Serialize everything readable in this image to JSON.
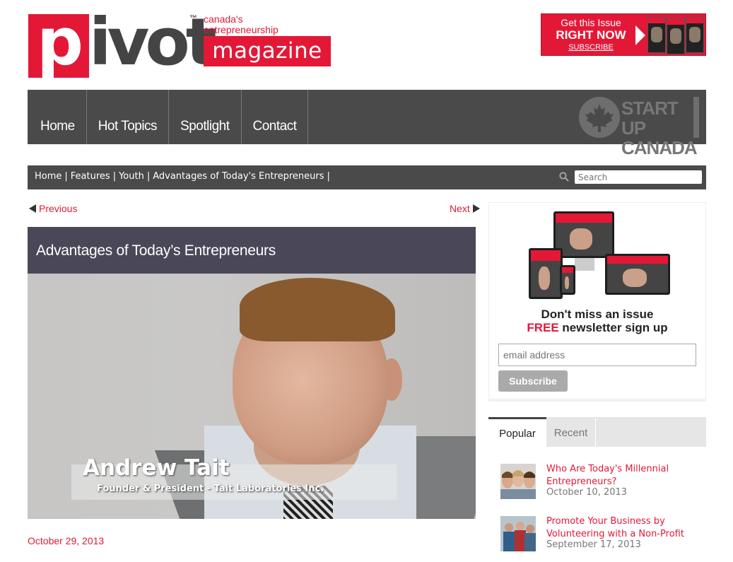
{
  "header": {
    "logo_p": "p",
    "logo_rest": "ivot",
    "logo_tm": "™",
    "tagline_1": "canada's",
    "tagline_2": "entrepreneurship",
    "logo_magazine": "magazine",
    "promo_line1": "Get this Issue",
    "promo_line2": "RIGHT NOW",
    "promo_line3": "SUBSCRIBE"
  },
  "nav": {
    "items": [
      "Home",
      "Hot Topics",
      "Spotlight",
      "Contact"
    ],
    "startup_1": "START UP",
    "startup_2": "CANADA"
  },
  "breadcrumb": {
    "items": [
      "Home",
      "Features",
      "Youth",
      "Advantages of Today's Entrepreneurs"
    ],
    "separator": "|",
    "search_placeholder": "Search"
  },
  "pager": {
    "previous": "Previous",
    "next": "Next"
  },
  "article": {
    "title": "Advantages of Today’s Entrepreneurs",
    "video_name": "Andrew Tait",
    "video_role": "Founder & President - Tait Laboratories Inc.",
    "date": "October 29, 2013"
  },
  "newsletter": {
    "line1": "Don't miss an issue",
    "free": "FREE",
    "line2_rest": " newsletter sign up",
    "email_placeholder": "email address",
    "subscribe": "Subscribe"
  },
  "tabs": {
    "popular": "Popular",
    "recent": "Recent"
  },
  "posts": [
    {
      "title": "Who Are Today's Millennial Entrepreneurs?",
      "date": "October 10, 2013"
    },
    {
      "title": "Promote Your Business by Volunteering with a Non-Profit",
      "date": "September 17, 2013"
    }
  ],
  "colors": {
    "brand_red": "#e31837",
    "nav_gray": "#4a4a4a",
    "title_bar": "#4a4758"
  }
}
